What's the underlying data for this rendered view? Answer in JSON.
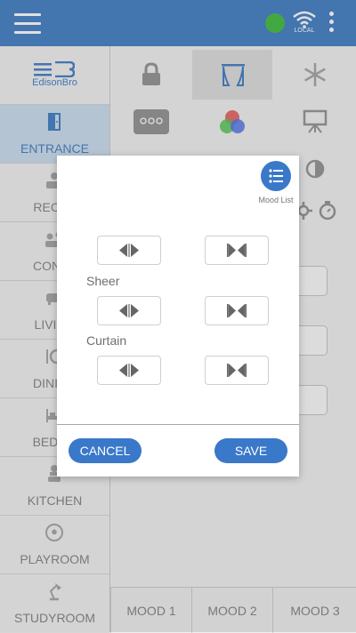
{
  "colors": {
    "brand": "#4d86c8",
    "accent": "#3a78c9",
    "status_online": "#4cc04c"
  },
  "header": {
    "wifi_label": "LOCAL"
  },
  "sidebar": {
    "brand": "EdisonBro",
    "rooms": [
      {
        "label": "ENTRANCE",
        "icon": "door-icon"
      },
      {
        "label": "RECEP",
        "icon": "reception-icon"
      },
      {
        "label": "CONFE",
        "icon": "conference-icon"
      },
      {
        "label": "LIVING",
        "icon": "sofa-icon"
      },
      {
        "label": "DINING",
        "icon": "dining-icon"
      },
      {
        "label": "BEDRO",
        "icon": "bed-icon"
      },
      {
        "label": "KITCHEN",
        "icon": "chef-icon"
      },
      {
        "label": "PLAYROOM",
        "icon": "ball-icon"
      },
      {
        "label": "STUDYROOM",
        "icon": "desk-lamp-icon"
      }
    ]
  },
  "main": {
    "categories": [
      "lock-icon",
      "curtain-icon",
      "snowflake-icon",
      "remote-icon",
      "rgb-icon",
      "projector-icon",
      "brightness-icon"
    ],
    "moods": [
      "MOOD 1",
      "MOOD 2",
      "MOOD 3"
    ]
  },
  "dialog": {
    "mood_list_label": "Mood List",
    "sections": [
      {
        "label": ""
      },
      {
        "label": "Sheer"
      },
      {
        "label": "Curtain"
      }
    ],
    "cancel_label": "CANCEL",
    "save_label": "SAVE"
  }
}
